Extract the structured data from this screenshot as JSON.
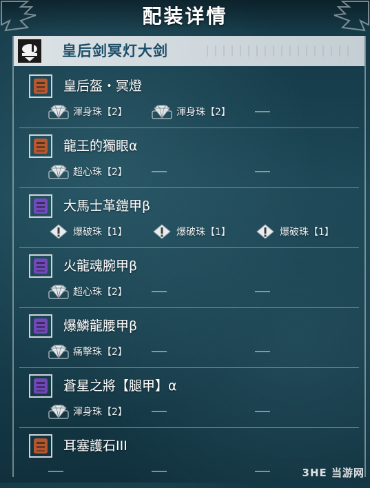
{
  "title": "配装详情",
  "weapon": {
    "name": "皇后剑冥灯大剑",
    "icon": "great-sword-icon"
  },
  "gear": [
    {
      "name": "皇后盔・冥燈",
      "icon": "helm-icon",
      "color": "#c85a2a",
      "slots": [
        {
          "jewel": "渾身珠【2】",
          "type": "diamond"
        },
        {
          "jewel": "渾身珠【2】",
          "type": "diamond"
        },
        {
          "jewel": "",
          "type": "empty"
        }
      ]
    },
    {
      "name": "龍王的獨眼α",
      "icon": "eyepatch-icon",
      "color": "#c85a2a",
      "slots": [
        {
          "jewel": "超心珠【2】",
          "type": "diamond"
        },
        {
          "jewel": "",
          "type": "empty"
        },
        {
          "jewel": "",
          "type": "empty"
        }
      ]
    },
    {
      "name": "大馬士革鎧甲β",
      "icon": "chest-armor-icon",
      "color": "#7a49c8",
      "slots": [
        {
          "jewel": "爆破珠【1】",
          "type": "exclaim"
        },
        {
          "jewel": "爆破珠【1】",
          "type": "exclaim"
        },
        {
          "jewel": "爆破珠【1】",
          "type": "exclaim"
        }
      ]
    },
    {
      "name": "火龍魂腕甲β",
      "icon": "arm-armor-icon",
      "color": "#7a49c8",
      "slots": [
        {
          "jewel": "超心珠【2】",
          "type": "diamond"
        },
        {
          "jewel": "",
          "type": "empty"
        },
        {
          "jewel": "",
          "type": "empty"
        }
      ]
    },
    {
      "name": "爆鱗龍腰甲β",
      "icon": "waist-armor-icon",
      "color": "#7a49c8",
      "slots": [
        {
          "jewel": "痛擊珠【2】",
          "type": "diamond"
        },
        {
          "jewel": "",
          "type": "empty"
        },
        {
          "jewel": "",
          "type": "empty"
        }
      ]
    },
    {
      "name": "蒼星之將【腿甲】α",
      "icon": "leg-armor-icon",
      "color": "#7a49c8",
      "slots": [
        {
          "jewel": "渾身珠【2】",
          "type": "diamond"
        },
        {
          "jewel": "",
          "type": "empty"
        },
        {
          "jewel": "",
          "type": "empty"
        }
      ]
    },
    {
      "name": "耳塞護石III",
      "icon": "charm-icon",
      "color": "#c85a2a",
      "slots": [
        {
          "jewel": "",
          "type": "empty"
        },
        {
          "jewel": "",
          "type": "empty"
        },
        {
          "jewel": "",
          "type": "empty"
        }
      ]
    }
  ],
  "watermark": "3HE 当游网"
}
